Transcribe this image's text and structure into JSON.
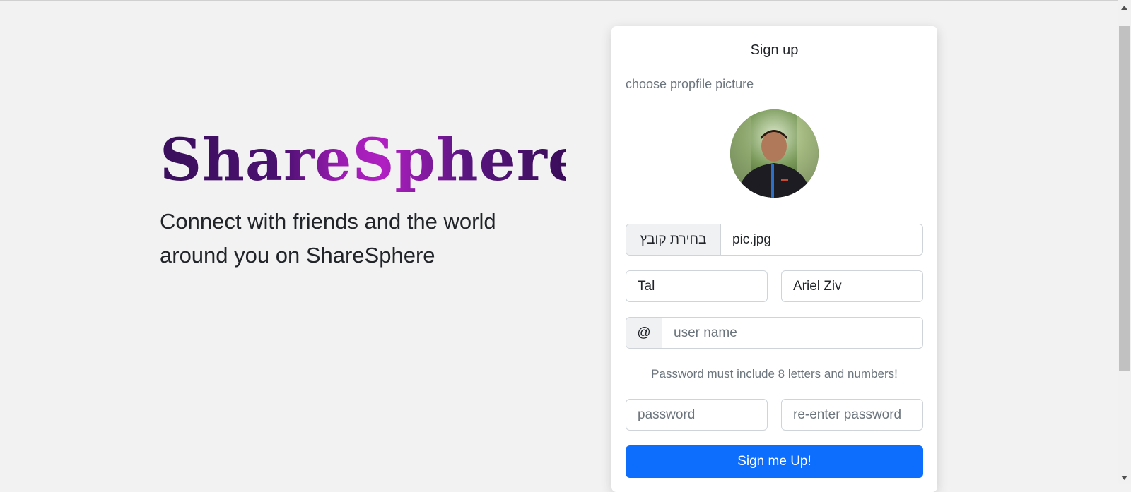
{
  "hero": {
    "logo": "ShareSphere",
    "tagline": "Connect with friends and the world around you on ShareSphere"
  },
  "signup": {
    "title": "Sign up",
    "choose_picture_label": "choose propfile picture",
    "file_button_label": "בחירת קובץ",
    "file_name": "pic.jpg",
    "first_name_value": "Tal",
    "last_name_value": "Ariel Ziv",
    "username_prefix": "@",
    "username_placeholder": "user name",
    "password_hint": "Password must include 8 letters and numbers!",
    "password_placeholder": "password",
    "reenter_placeholder": "re-enter password",
    "submit_label": "Sign me Up!"
  },
  "colors": {
    "primary": "#0d6efd",
    "background": "#f2f2f2",
    "logo_purple": "#4a1070",
    "logo_magenta": "#b01fc2"
  }
}
